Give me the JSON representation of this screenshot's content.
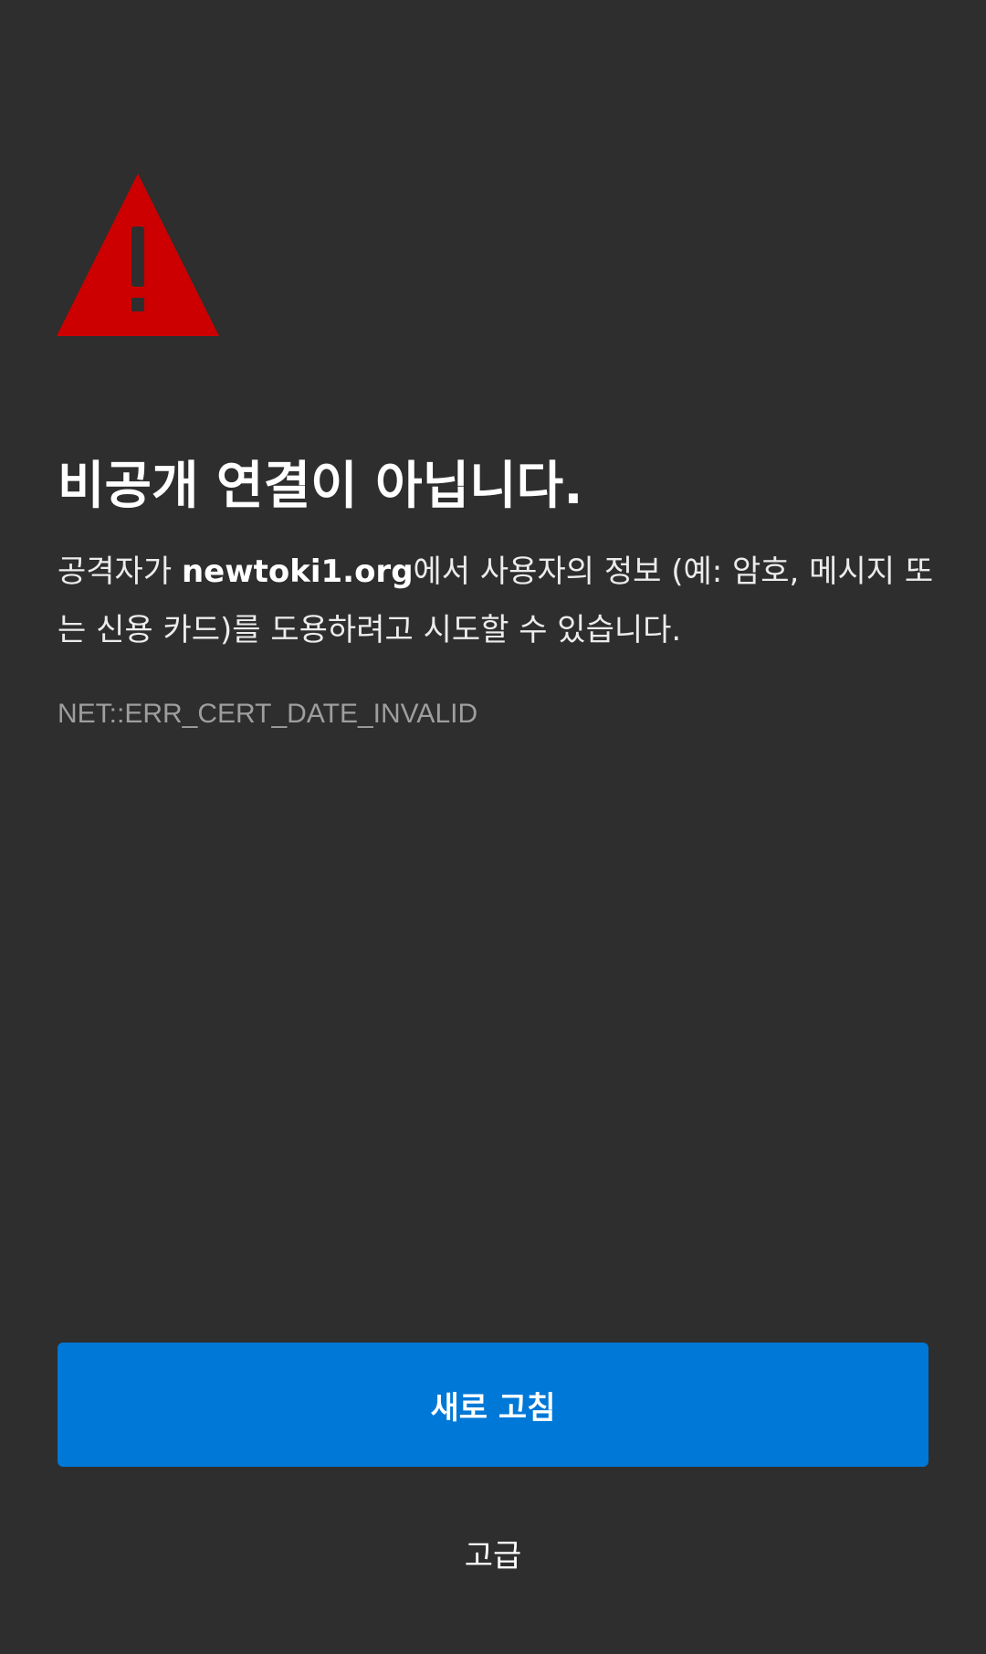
{
  "interstitial": {
    "warning_icon": "warning-triangle-icon",
    "title": "비공개 연결이 아닙니다.",
    "description_before": "공격자가 ",
    "domain": "newtoki1.org",
    "description_after": "에서 사용자의 정보 (예: 암호, 메시지 또는 신용 카드)를 도용하려고 시도할 수 있습니다.",
    "error_code": "NET::ERR_CERT_DATE_INVALID"
  },
  "actions": {
    "reload_label": "새로 고침",
    "advanced_label": "고급"
  },
  "colors": {
    "background": "#2e2e2e",
    "warning_red": "#cc0000",
    "primary_button": "#0078d7",
    "error_code_text": "#9e9e9e"
  }
}
